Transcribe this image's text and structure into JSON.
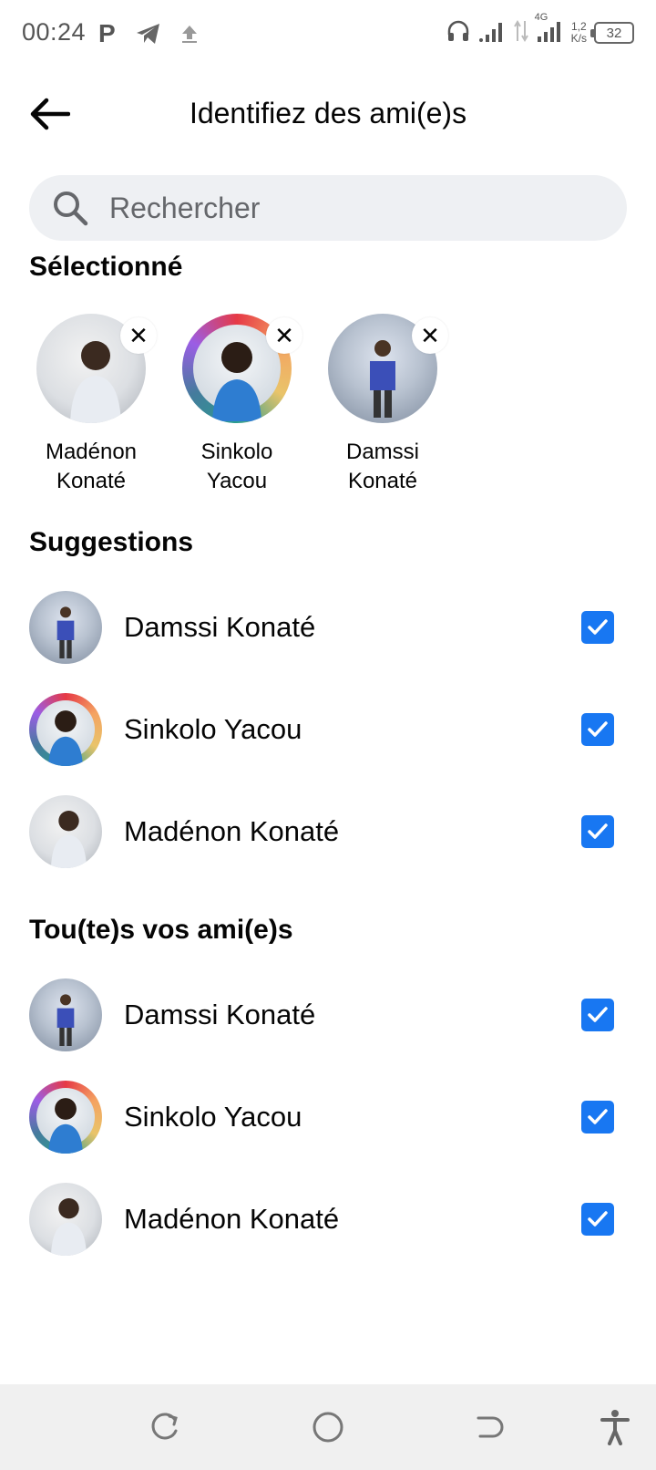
{
  "status_bar": {
    "time": "00:24",
    "network_type": "4G",
    "speed_value": "1,2",
    "speed_unit": "K/s",
    "battery": "32"
  },
  "header": {
    "title": "Identifiez des ami(e)s"
  },
  "search": {
    "placeholder": "Rechercher"
  },
  "selected": {
    "title": "Sélectionné",
    "items": [
      {
        "name_line1": "Madénon",
        "name_line2": "Konaté"
      },
      {
        "name_line1": "Sinkolo",
        "name_line2": "Yacou"
      },
      {
        "name_line1": "Damssi",
        "name_line2": "Konaté"
      }
    ]
  },
  "suggestions": {
    "title": "Suggestions",
    "items": [
      {
        "name": "Damssi Konaté",
        "checked": true
      },
      {
        "name": "Sinkolo Yacou",
        "checked": true
      },
      {
        "name": "Madénon Konaté",
        "checked": true
      }
    ]
  },
  "all_friends": {
    "title": "Tou(te)s vos ami(e)s",
    "items": [
      {
        "name": "Damssi Konaté",
        "checked": true
      },
      {
        "name": "Sinkolo Yacou",
        "checked": true
      },
      {
        "name": "Madénon Konaté",
        "checked": true
      }
    ]
  },
  "colors": {
    "accent": "#1877f2",
    "search_bg": "#eef0f3",
    "nav_bg": "#f0f0f0"
  },
  "icons": {
    "back": "arrow-left-icon",
    "search": "search-icon",
    "remove": "close-icon",
    "check": "checkmark-icon",
    "nav_recent": "recent-apps-icon",
    "nav_home": "home-icon",
    "nav_back": "back-icon",
    "nav_accessibility": "accessibility-icon"
  }
}
